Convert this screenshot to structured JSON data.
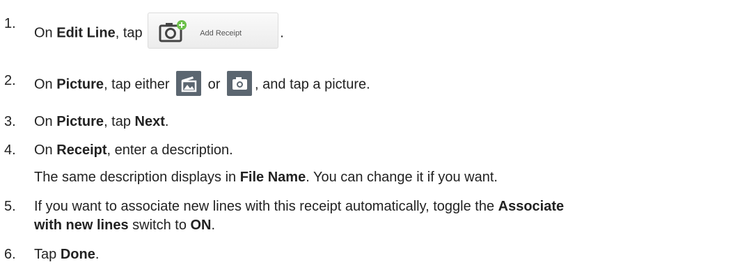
{
  "steps": [
    {
      "num": "1.",
      "before": "On ",
      "b1": "Edit Line",
      "after": ", tap ",
      "button_label": "Add Receipt",
      "end": "."
    },
    {
      "num": "2.",
      "before": "On ",
      "b1": "Picture",
      "mid": ", tap either ",
      "or": " or ",
      "end": ", and tap a picture."
    },
    {
      "num": "3.",
      "before": "On ",
      "b1": "Picture",
      "mid": ", tap ",
      "b2": "Next",
      "end": "."
    },
    {
      "num": "4.",
      "before": "On ",
      "b1": "Receipt",
      "end": ", enter a description."
    },
    {
      "note_before": "The same description displays in ",
      "note_bold": "File Name",
      "note_after": ". You can change it if you want."
    },
    {
      "num": "5.",
      "line1_before": "If you want to associate new lines with this receipt automatically, toggle the ",
      "line1_bold": "Associate",
      "line2_bold": "with new lines",
      "line2_mid": " switch to ",
      "line2_bold2": "ON",
      "line2_end": "."
    },
    {
      "num": "6.",
      "before": "Tap ",
      "b1": "Done",
      "end": "."
    }
  ],
  "icons": {
    "gallery": "gallery-icon",
    "camera": "camera-icon",
    "add_camera": "add-camera-icon",
    "icon_bg": "#5b6670",
    "accent_green": "#6cc04a"
  }
}
